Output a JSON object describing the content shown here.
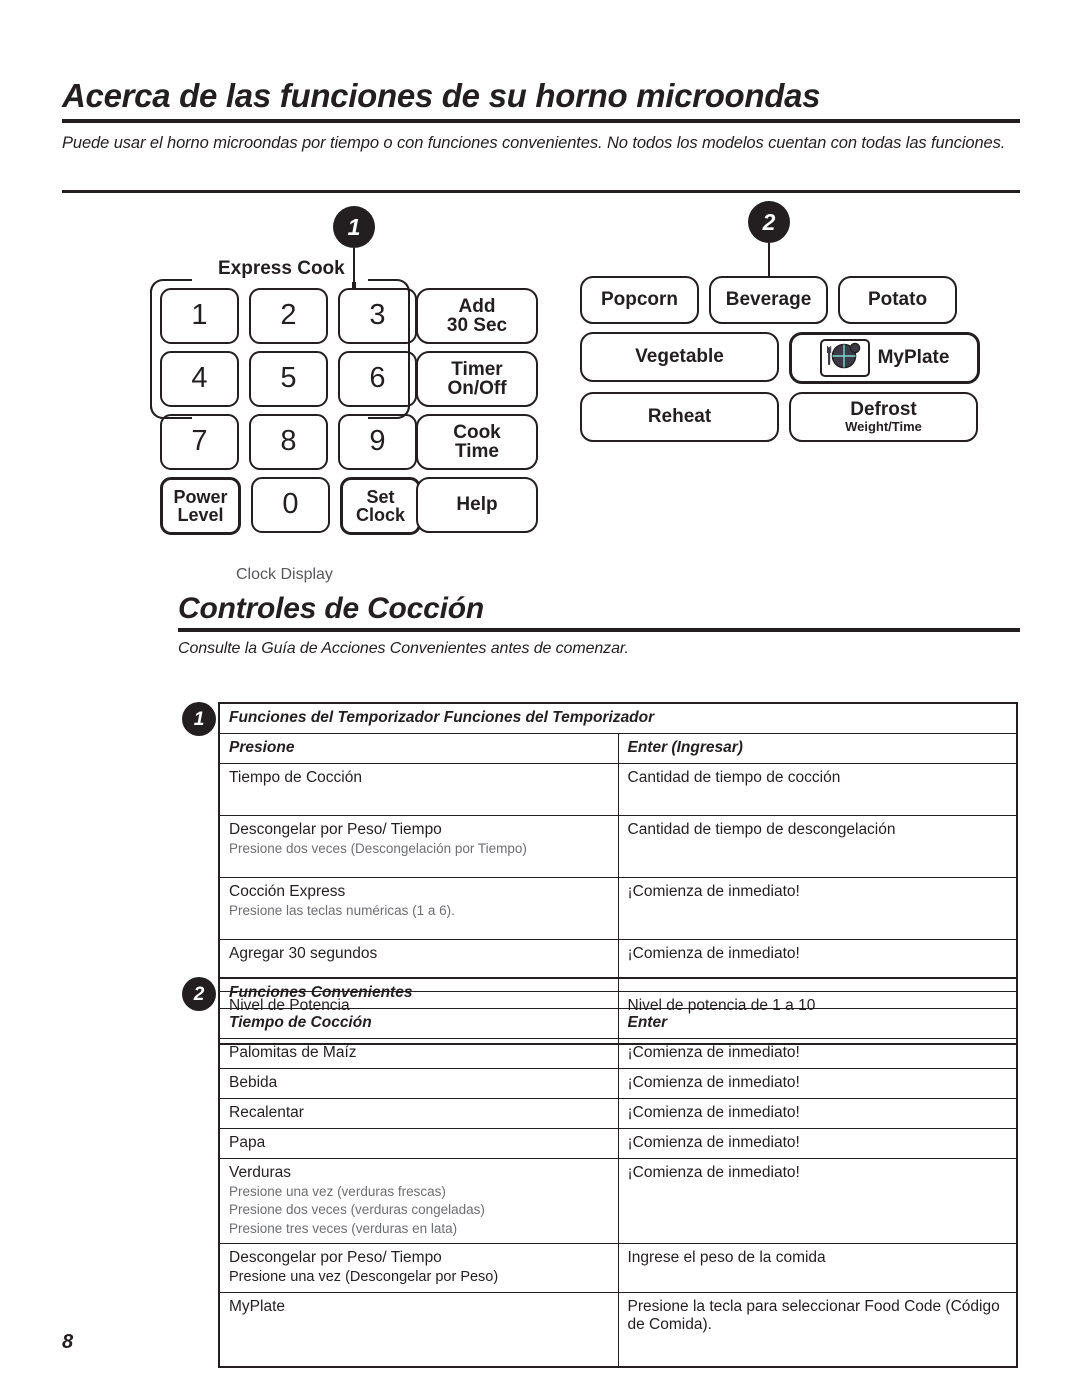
{
  "header": {
    "title": "Acerca de las funciones de su horno microondas",
    "intro": "Puede usar el horno microondas por tiempo o con funciones convenientes. No todos los modelos cuentan con todas las funciones."
  },
  "diagram": {
    "callout_1": "1",
    "callout_2": "2",
    "express_cook_label": "Express Cook",
    "clock_display_label": "Clock Display",
    "keypad": {
      "row1": [
        "1",
        "2",
        "3"
      ],
      "row2": [
        "4",
        "5",
        "6"
      ],
      "row3": [
        "7",
        "8",
        "9"
      ],
      "row4": [
        "Power Level",
        "0",
        "Set Clock"
      ],
      "power_level_line1": "Power",
      "power_level_line2": "Level",
      "set_clock_line1": "Set",
      "set_clock_line2": "Clock",
      "zero": "0"
    },
    "function_keys": [
      {
        "line1": "Add",
        "line2": "30 Sec"
      },
      {
        "line1": "Timer",
        "line2": "On/Off"
      },
      {
        "line1": "Cook",
        "line2": "Time"
      },
      {
        "line1": "Help",
        "line2": ""
      }
    ],
    "convenience_buttons": {
      "popcorn": "Popcorn",
      "beverage": "Beverage",
      "potato": "Potato",
      "vegetable": "Vegetable",
      "myplate": "MyPlate",
      "reheat": "Reheat",
      "defrost_main": "Defrost",
      "defrost_sub": "Weight/Time"
    },
    "icons": {
      "plate": "plate-icon"
    }
  },
  "section2": {
    "title": "Controles de Cocción",
    "subtitle": "Consulte la Guía de Acciones Convenientes antes de comenzar."
  },
  "table1": {
    "badge": "1",
    "title": "Funciones del Temporizador Funciones del Temporizador",
    "col1_header": "Presione",
    "col2_header": "Enter (Ingresar)",
    "rows": [
      {
        "label": "Tiempo de Cocción",
        "note": "",
        "value": "Cantidad de tiempo de cocción"
      },
      {
        "label": "Descongelar por Peso/ Tiempo",
        "note": "Presione dos veces (Descongelación por Tiempo)",
        "value": "Cantidad de tiempo de descongelación"
      },
      {
        "label": "Cocción Express",
        "note": "Presione las teclas numéricas (1 a 6).",
        "value": "¡Comienza de inmediato!"
      },
      {
        "label": "Agregar 30 segundos",
        "note": "",
        "value": "¡Comienza de inmediato!"
      },
      {
        "label": "Nivel de Potencia",
        "note": "",
        "value": "Nivel de potencia de 1 a 10"
      }
    ]
  },
  "table2": {
    "badge": "2",
    "title": "Funciones Convenientes",
    "col1_header": "Tiempo de Cocción",
    "col2_header": "Enter",
    "rows": [
      {
        "label": "Palomitas de Maíz",
        "note": "",
        "note2": "",
        "note3": "",
        "value": "¡Comienza de inmediato!"
      },
      {
        "label": "Bebida",
        "note": "",
        "note2": "",
        "note3": "",
        "value": "¡Comienza de inmediato!"
      },
      {
        "label": "Recalentar",
        "note": "",
        "note2": "",
        "note3": "",
        "value": "¡Comienza de inmediato!"
      },
      {
        "label": "Papa",
        "note": "",
        "note2": "",
        "note3": "",
        "value": "¡Comienza de inmediato!"
      },
      {
        "label": "Verduras",
        "note": "Presione una vez (verduras frescas)",
        "note2": "Presione dos veces (verduras congeladas)",
        "note3": "Presione tres veces (verduras en lata)",
        "value": "¡Comienza de inmediato!"
      },
      {
        "label": "Descongelar por Peso/ Tiempo",
        "note": "Presione una vez (Descongelar por Peso)",
        "note2": "",
        "note3": "",
        "value": "Ingrese el peso de la comida"
      },
      {
        "label": "MyPlate",
        "note": "",
        "note2": "",
        "note3": "",
        "value": "Presione la tecla para seleccionar Food Code (Código de Comida)."
      }
    ]
  },
  "footer": {
    "page_number": "8"
  }
}
